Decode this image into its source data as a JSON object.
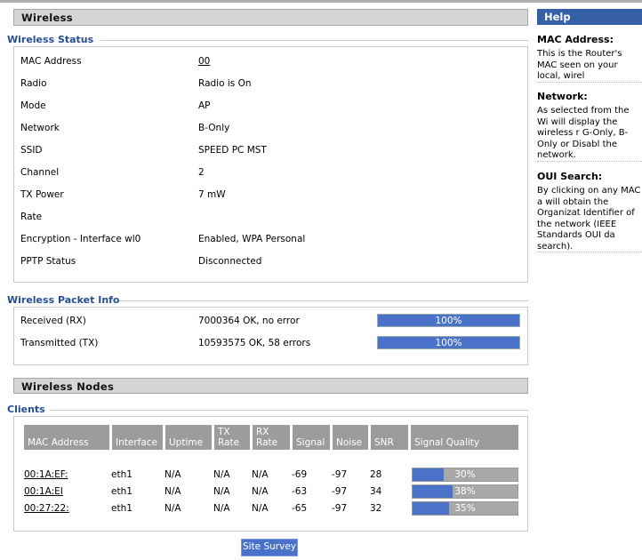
{
  "header": {
    "title": "Wireless",
    "help_title": "Help"
  },
  "status": {
    "title": "Wireless Status",
    "rows": [
      {
        "label": "MAC Address",
        "value": "00",
        "link": true
      },
      {
        "label": "Radio",
        "value": "Radio is On"
      },
      {
        "label": "Mode",
        "value": "AP"
      },
      {
        "label": "Network",
        "value": "B-Only"
      },
      {
        "label": "SSID",
        "value": "SPEED PC MST"
      },
      {
        "label": "Channel",
        "value": "2"
      },
      {
        "label": "TX Power",
        "value": "7   mW"
      },
      {
        "label": "Rate",
        "value": ""
      },
      {
        "label": "Encryption - Interface wl0",
        "value": "Enabled, WPA Personal"
      },
      {
        "label": "PPTP Status",
        "value": "Disconnected"
      }
    ]
  },
  "packets": {
    "title": "Wireless Packet Info",
    "rows": [
      {
        "label": "Received (RX)",
        "value": "7000364 OK, no error",
        "percent": 100,
        "percent_label": "100%"
      },
      {
        "label": "Transmitted (TX)",
        "value": "10593575 OK, 58 errors",
        "percent": 100,
        "percent_label": "100%"
      }
    ]
  },
  "nodes": {
    "title": "Wireless Nodes",
    "clients_title": "Clients",
    "columns": [
      "MAC Address",
      "Interface",
      "Uptime",
      "TX Rate",
      "RX Rate",
      "Signal",
      "Noise",
      "SNR",
      "Signal Quality"
    ],
    "rows": [
      {
        "mac": "00:1A:EF:",
        "iface": "eth1",
        "uptime": "N/A",
        "tx": "N/A",
        "rx": "N/A",
        "signal": "-69",
        "noise": "-97",
        "snr": "28",
        "quality": 30,
        "quality_label": "30%"
      },
      {
        "mac": "00:1A:EI",
        "iface": "eth1",
        "uptime": "N/A",
        "tx": "N/A",
        "rx": "N/A",
        "signal": "-63",
        "noise": "-97",
        "snr": "34",
        "quality": 38,
        "quality_label": "38%"
      },
      {
        "mac": "00:27:22:",
        "iface": "eth1",
        "uptime": "N/A",
        "tx": "N/A",
        "rx": "N/A",
        "signal": "-65",
        "noise": "-97",
        "snr": "32",
        "quality": 35,
        "quality_label": "35%"
      }
    ],
    "site_survey": "Site Survey"
  },
  "help": [
    {
      "title": "MAC Address:",
      "text": "This is the Router's MAC seen on your local, wirel"
    },
    {
      "title": "Network:",
      "text": "As selected from the Wi will display the wireless r G-Only, B-Only or Disabl the network."
    },
    {
      "title": "OUI Search:",
      "text": "By clicking on any MAC a will obtain the Organizat Identifier of the network (IEEE Standards OUI da search)."
    }
  ]
}
